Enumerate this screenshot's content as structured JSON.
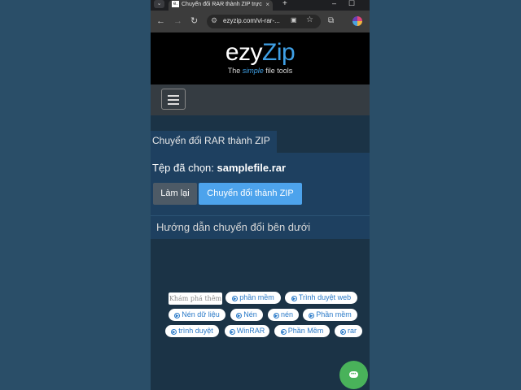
{
  "browser": {
    "tab_title": "Chuyển đổi RAR thành ZIP trực",
    "tab_favicon": "e.",
    "url": "ezyzip.com/vi-rar-...",
    "new_tab": "+",
    "window_controls": [
      "–",
      "☐"
    ]
  },
  "site": {
    "logo_ezy": "ezy",
    "logo_zip": "Zip",
    "tagline_before": "The",
    "tagline_simple": "simple",
    "tagline_after": "file tools"
  },
  "page": {
    "title": "Chuyển đổi RAR thành ZIP",
    "selected_label": "Tệp đã chọn:",
    "selected_file": "samplefile.rar",
    "reset_button": "Làm lại",
    "convert_button": "Chuyển đổi thành ZIP",
    "guide_heading": "Hướng dẫn chuyển đổi bên dưới"
  },
  "tags": {
    "search_placeholder": "Khám phá thêm",
    "items": [
      "phần mềm",
      "Trình duyệt web",
      "Nén dữ liệu",
      "Nén",
      "nén",
      "Phần mềm",
      "trình duyệt",
      "WinRAR",
      "Phần Mềm",
      "rar"
    ]
  },
  "colors": {
    "accent": "#3fa0e6",
    "convert_button": "#4da3ec",
    "chat": "#49b25a"
  }
}
